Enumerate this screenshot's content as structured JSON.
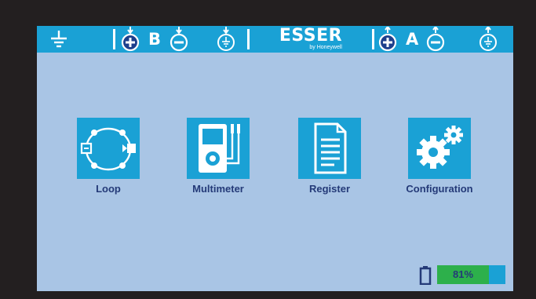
{
  "header": {
    "ground_icon": "ground-icon",
    "terminal_b": {
      "letter": "B",
      "plus_icon": "plus-circle-icon",
      "minus_icon": "minus-circle-icon",
      "earth_icon": "earth-circle-icon"
    },
    "brand": {
      "name": "ESSER",
      "subtitle": "by Honeywell"
    },
    "terminal_a": {
      "letter": "A",
      "plus_icon": "plus-circle-icon",
      "minus_icon": "minus-circle-icon",
      "earth_icon": "earth-circle-icon"
    }
  },
  "menu": {
    "items": [
      {
        "label": "Loop",
        "icon": "loop-icon"
      },
      {
        "label": "Multimeter",
        "icon": "multimeter-icon"
      },
      {
        "label": "Register",
        "icon": "register-document-icon"
      },
      {
        "label": "Configuration",
        "icon": "gears-icon"
      }
    ]
  },
  "battery": {
    "label": "81%",
    "level_percent": 81,
    "icon": "battery-icon"
  },
  "colors": {
    "accent": "#1aa1d5",
    "background": "#a9c5e5",
    "frame": "#231f20",
    "label": "#243a78",
    "battery_fill": "#2db04b"
  }
}
